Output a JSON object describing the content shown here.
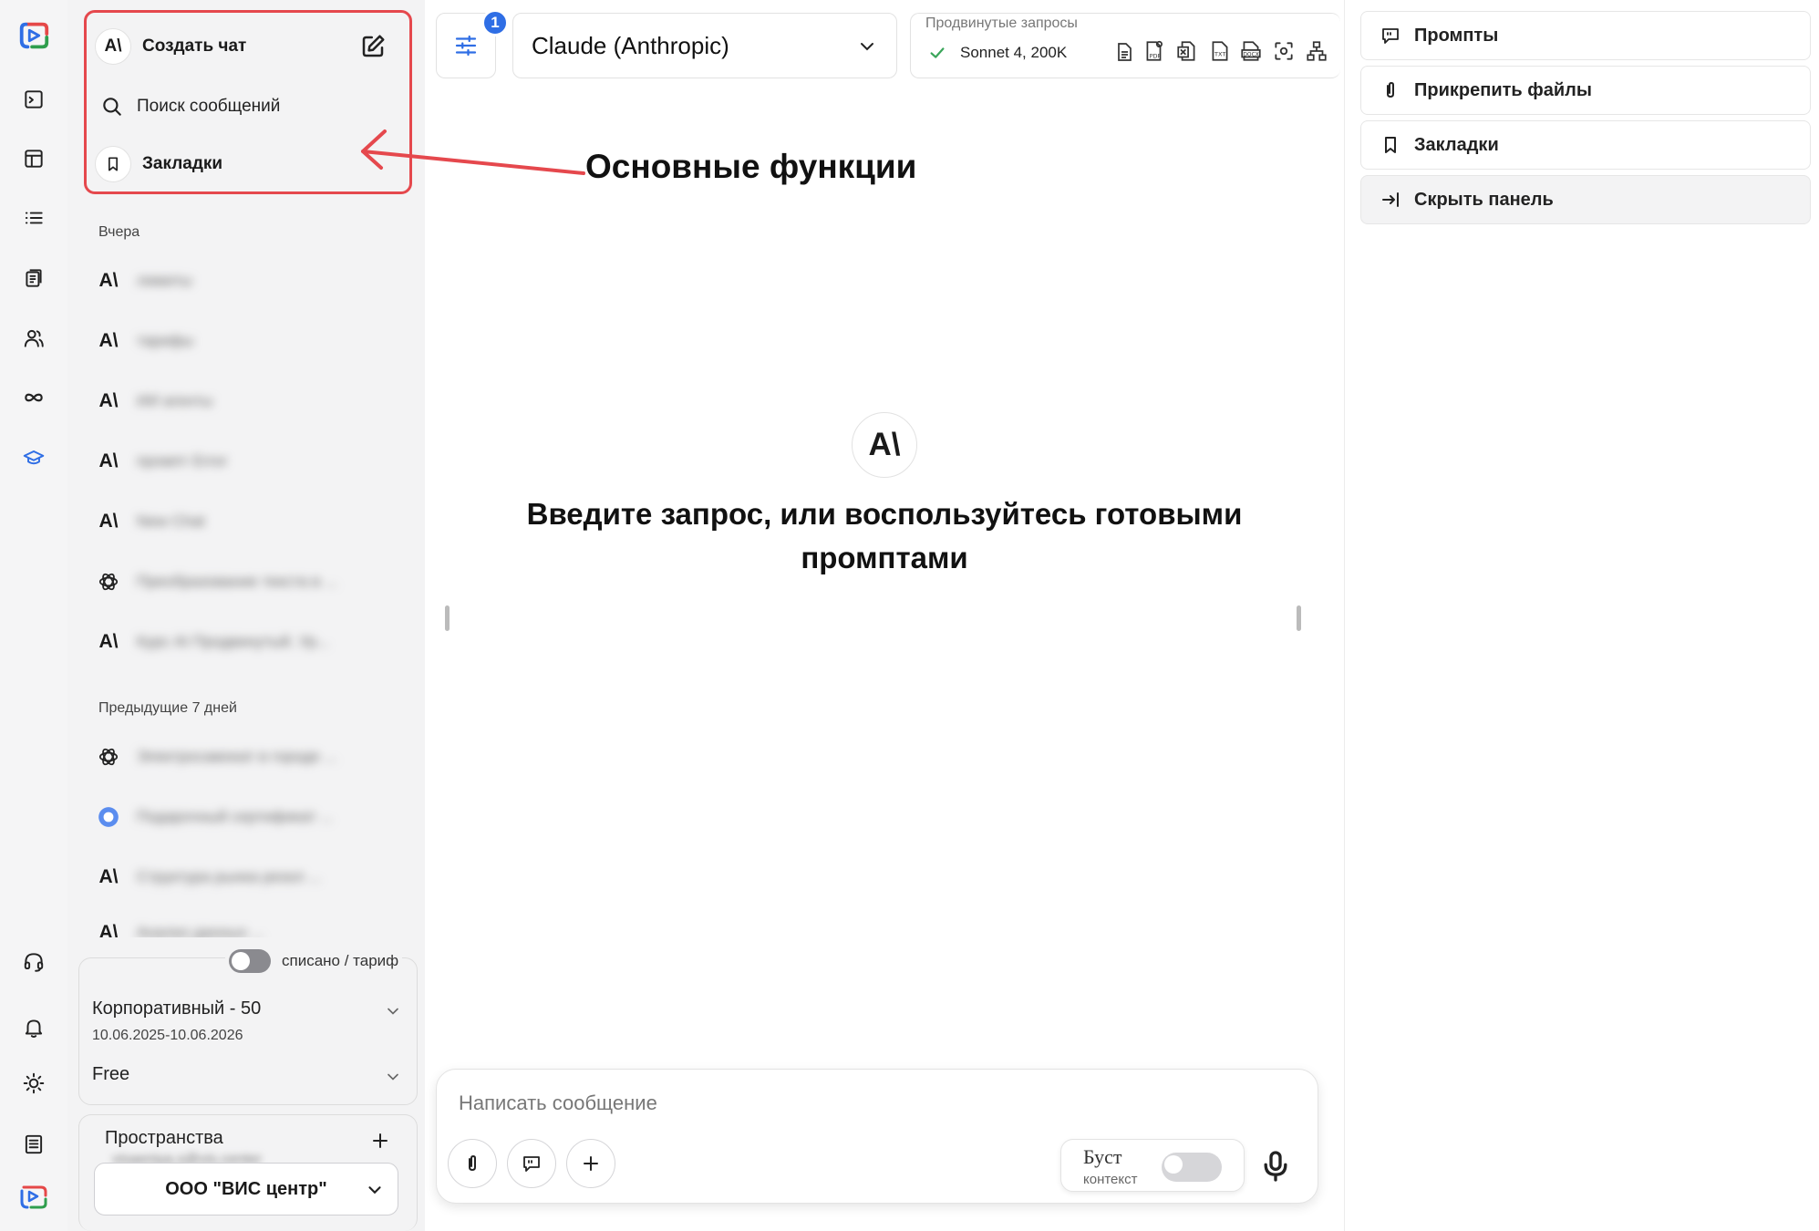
{
  "sidebar": {
    "new_chat_label": "Создать чат",
    "search_label": "Поиск сообщений",
    "bookmarks_label": "Закладки",
    "model_logo": "A\\",
    "sections": [
      {
        "label": "Вчера",
        "items": [
          {
            "icon": "anthropic-icon",
            "title": "лимиты"
          },
          {
            "icon": "anthropic-icon",
            "title": "тарифы"
          },
          {
            "icon": "anthropic-icon",
            "title": "ИИ агенты"
          },
          {
            "icon": "anthropic-icon",
            "title": "промпт Error"
          },
          {
            "icon": "anthropic-icon",
            "title": "New Chat"
          },
          {
            "icon": "openai-icon",
            "title": "Преобразование текста в ..."
          },
          {
            "icon": "anthropic-icon",
            "title": "Курс AI Продвинутый. Ур..."
          }
        ]
      },
      {
        "label": "Предыдущие 7 дней",
        "items": [
          {
            "icon": "openai-icon",
            "title": "Электросамокат в городе ..."
          },
          {
            "icon": "gemini-icon",
            "title": "Подарочный сертификат ..."
          },
          {
            "icon": "anthropic-icon",
            "title": "Структура рынка резол ..."
          },
          {
            "icon": "anthropic-icon",
            "title": "Анализ данных ..."
          }
        ]
      }
    ],
    "plan": {
      "toggle_label": "списано / тариф",
      "plan_name": "Корпоративный - 50",
      "plan_dates": "10.06.2025-10.06.2026",
      "tier": "Free"
    },
    "spaces": {
      "title": "Пространства",
      "email": "visaeniya.s@vis.center",
      "company": "ООО \"ВИС центр\""
    }
  },
  "header": {
    "badge_count": "1",
    "model_name": "Claude (Anthropic)",
    "advanced_label": "Продвинутые запросы",
    "advanced_value": "Sonnet 4, 200K"
  },
  "annotation": {
    "text": "Основные функции"
  },
  "main": {
    "logo": "A\\",
    "welcome_text": "Введите запрос, или воспользуйтесь готовыми промптами"
  },
  "composer": {
    "placeholder": "Написать сообщение",
    "boost_label": "Буст",
    "boost_sublabel": "контекст"
  },
  "right_panel": {
    "items": [
      {
        "label": "Промпты"
      },
      {
        "label": "Прикрепить файлы"
      },
      {
        "label": "Закладки"
      },
      {
        "label": "Скрыть панель"
      }
    ]
  },
  "colors": {
    "accent": "#2f6ee5",
    "annotation": "#e5484d",
    "check": "#3aa55a"
  }
}
